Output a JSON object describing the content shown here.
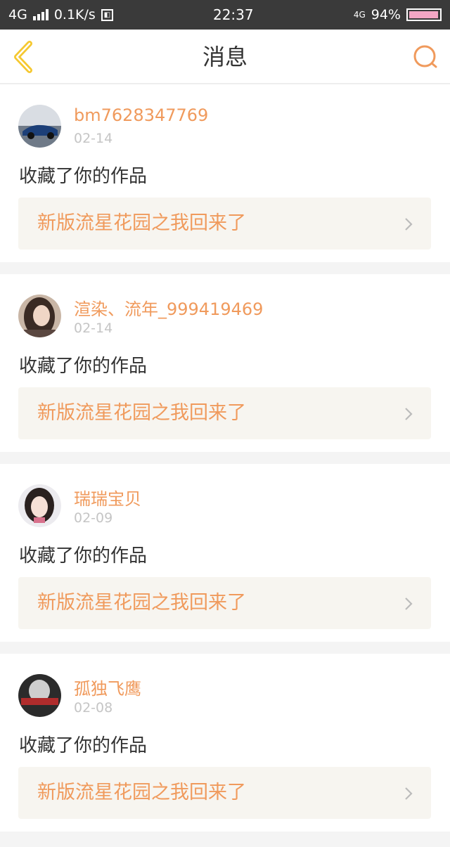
{
  "status": {
    "network": "4G",
    "speed": "0.1K/s",
    "time": "22:37",
    "network_right": "4G",
    "battery": "94%"
  },
  "header": {
    "title": "消息",
    "back_icon": "chevron-left-icon",
    "search_icon": "search-icon"
  },
  "colors": {
    "accent": "#f09a5c",
    "back_icon": "#f5c830",
    "text": "#333333",
    "date": "#c5c5c5",
    "link_bg": "#f7f5f0"
  },
  "messages": [
    {
      "username": "bm7628347769",
      "date": "02-14",
      "action": "收藏了你的作品",
      "work_title": "新版流星花园之我回来了"
    },
    {
      "username": "渲染、流年_999419469",
      "date": "02-14",
      "action": "收藏了你的作品",
      "work_title": "新版流星花园之我回来了"
    },
    {
      "username": "瑞瑞宝贝",
      "date": "02-09",
      "action": "收藏了你的作品",
      "work_title": "新版流星花园之我回来了"
    },
    {
      "username": "孤独飞鹰",
      "date": "02-08",
      "action": "收藏了你的作品",
      "work_title": "新版流星花园之我回来了"
    }
  ]
}
